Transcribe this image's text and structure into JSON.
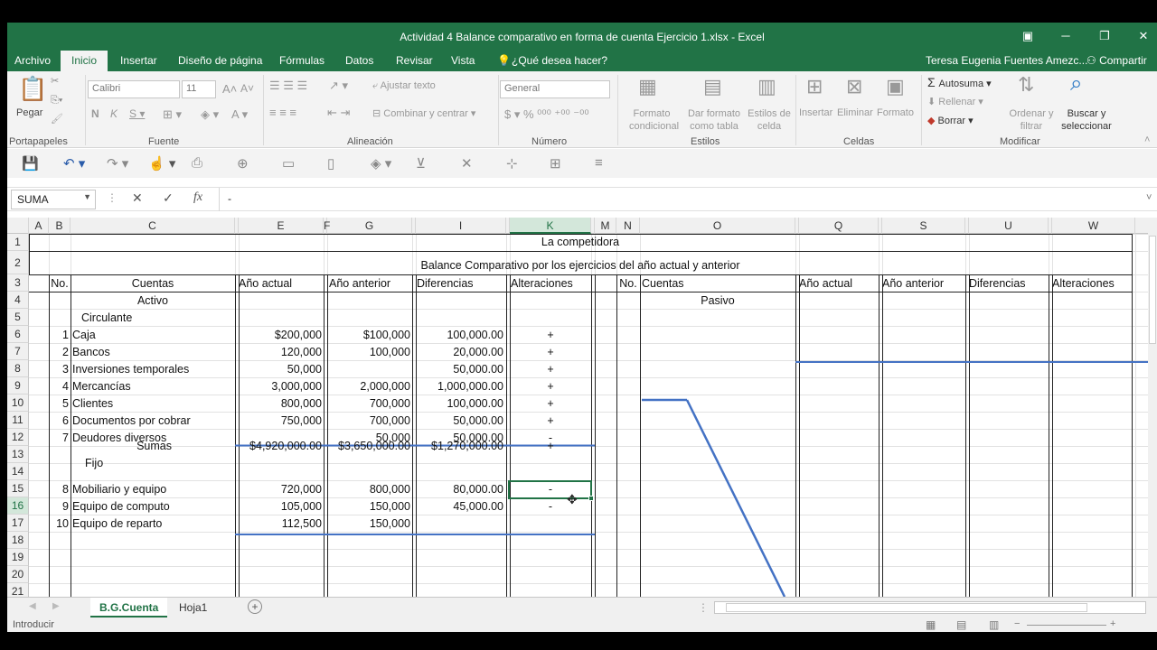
{
  "window": {
    "title": "Actividad 4 Balance comparativo en forma de cuenta Ejercicio 1.xlsx - Excel",
    "user": "Teresa Eugenia Fuentes Amezc...",
    "share": "Compartir"
  },
  "tabs": [
    {
      "label": "Archivo"
    },
    {
      "label": "Inicio"
    },
    {
      "label": "Insertar"
    },
    {
      "label": "Diseño de página"
    },
    {
      "label": "Fórmulas"
    },
    {
      "label": "Datos"
    },
    {
      "label": "Revisar"
    },
    {
      "label": "Vista"
    }
  ],
  "tell_me": "¿Qué desea hacer?",
  "ribbon": {
    "paste": "Pegar",
    "font_name": "Calibri",
    "font_size": "11",
    "wrap_text": "Ajustar texto",
    "merge": "Combinar y centrar",
    "number_format": "General",
    "cond_format": "Formato condicional",
    "table_format": "Dar formato como tabla",
    "cell_styles": "Estilos de celda",
    "insert": "Insertar",
    "delete": "Eliminar",
    "format": "Formato",
    "autosum": "Autosuma",
    "fill": "Rellenar",
    "clear": "Borrar",
    "sort": "Ordenar y filtrar",
    "find": "Buscar y seleccionar",
    "groups": {
      "clipboard": "Portapapeles",
      "font": "Fuente",
      "alignment": "Alineación",
      "number": "Número",
      "styles": "Estilos",
      "cells": "Celdas",
      "editing": "Modificar"
    }
  },
  "formula_bar": {
    "name_box": "SUMA",
    "fx": "fx",
    "content": "-"
  },
  "columns": [
    "A",
    "B",
    "C",
    "",
    "E",
    "F",
    "G",
    "",
    "I",
    "",
    "K",
    "",
    "M",
    "N",
    "O",
    "",
    "Q",
    "",
    "S",
    "",
    "U",
    "",
    "W"
  ],
  "rows": [
    "1",
    "2",
    "3",
    "4",
    "5",
    "6",
    "7",
    "8",
    "9",
    "10",
    "11",
    "12",
    "13",
    "14",
    "15",
    "16",
    "17",
    "18",
    "19",
    "20",
    "21"
  ],
  "sheet": {
    "title1": "La competidora",
    "title2": "Balance Comparativo por los ejercicios del año actual y anterior",
    "headers": {
      "no": "No.",
      "cuentas": "Cuentas",
      "anio_actual": "Año actual",
      "anio_anterior": "Año anterior",
      "diferencias": "Diferencias",
      "alteraciones": "Alteraciones",
      "pasivo": "Pasivo"
    },
    "activo": "Activo",
    "circulante": "Circulante",
    "fijo": "Fijo",
    "sumas": "Sumas",
    "items": [
      {
        "no": "1",
        "cuenta": "Caja",
        "actual": "$200,000",
        "anterior": "$100,000",
        "dif": "100,000.00",
        "alt": "+"
      },
      {
        "no": "2",
        "cuenta": "Bancos",
        "actual": "120,000",
        "anterior": "100,000",
        "dif": "20,000.00",
        "alt": "+"
      },
      {
        "no": "3",
        "cuenta": "Inversiones temporales",
        "actual": "50,000",
        "anterior": "",
        "dif": "50,000.00",
        "alt": "+"
      },
      {
        "no": "4",
        "cuenta": "Mercancías",
        "actual": "3,000,000",
        "anterior": "2,000,000",
        "dif": "1,000,000.00",
        "alt": "+"
      },
      {
        "no": "5",
        "cuenta": "Clientes",
        "actual": "800,000",
        "anterior": "700,000",
        "dif": "100,000.00",
        "alt": "+"
      },
      {
        "no": "6",
        "cuenta": "Documentos por cobrar",
        "actual": "750,000",
        "anterior": "700,000",
        "dif": "50,000.00",
        "alt": "+"
      },
      {
        "no": "7",
        "cuenta": "Deudores diversos",
        "actual": "",
        "anterior": "50,000",
        "dif": "50,000.00",
        "alt": "-"
      }
    ],
    "sumas_row": {
      "actual": "$4,920,000.00",
      "anterior": "$3,650,000.00",
      "dif": "$1,270,000.00",
      "alt": "+"
    },
    "fijo_items": [
      {
        "no": "8",
        "cuenta": "Mobiliario y equipo",
        "actual": "720,000",
        "anterior": "800,000",
        "dif": "80,000.00",
        "alt": "-"
      },
      {
        "no": "9",
        "cuenta": "Equipo de computo",
        "actual": "105,000",
        "anterior": "150,000",
        "dif": "45,000.00",
        "alt": "-"
      },
      {
        "no": "10",
        "cuenta": "Equipo de reparto",
        "actual": "112,500",
        "anterior": "150,000",
        "dif": "",
        "alt": ""
      }
    ]
  },
  "sheet_tabs": [
    {
      "label": "B.G.Cuenta"
    },
    {
      "label": "Hoja1"
    }
  ],
  "status": "Introducir",
  "colors": {
    "accent": "#217346",
    "shape_line": "#4472c4"
  }
}
